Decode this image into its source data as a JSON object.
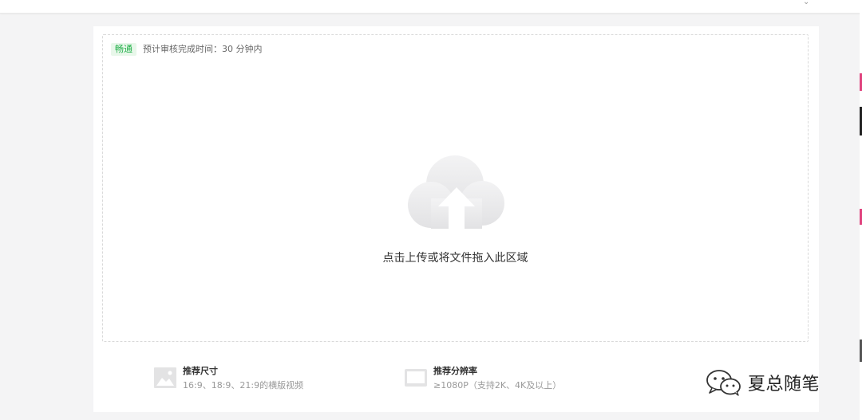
{
  "topbar": {
    "caret_glyph": "⌄"
  },
  "dropzone": {
    "badge": "畅通",
    "eta": "预计审核完成时间：30 分钟内",
    "upload_text": "点击上传或将文件拖入此区域",
    "icon": "cloud-upload-icon"
  },
  "specs": [
    {
      "icon": "image-icon",
      "title": "推荐尺寸",
      "desc": "16:9、18:9、21:9的横版视频"
    },
    {
      "icon": "screen-icon",
      "title": "推荐分辨率",
      "desc": "≥1080P（支持2K、4K及以上）"
    }
  ],
  "watermark": {
    "icon": "wechat-icon",
    "text": "夏总随笔"
  },
  "colors": {
    "badge_bg": "#e8f7ea",
    "badge_text": "#23b04a",
    "edge_pink": "#e0437e"
  }
}
